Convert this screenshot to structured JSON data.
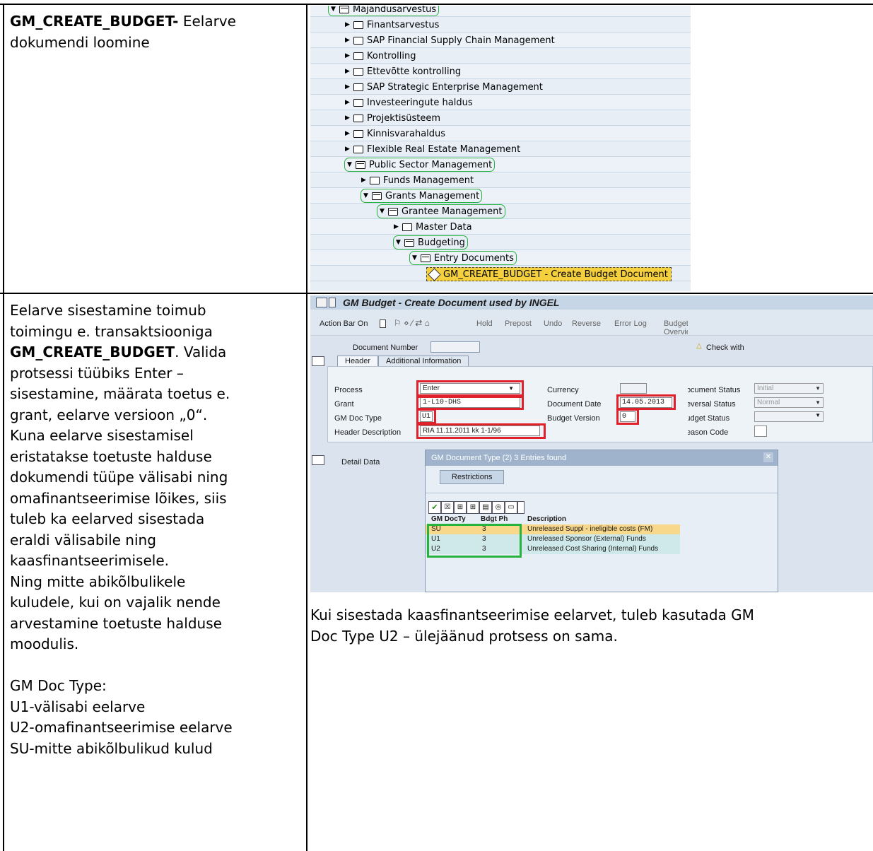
{
  "row1": {
    "left_bold": "GM_CREATE_BUDGET-",
    "left_rest": " Eelarve",
    "left_line2": "dokumendi loomine",
    "tree": [
      {
        "label": "Majandusarvestus",
        "open": true,
        "level": 0,
        "highlight": true
      },
      {
        "label": "Finantsarvestus",
        "open": false,
        "level": 1
      },
      {
        "label": "SAP Financial Supply Chain Management",
        "open": false,
        "level": 1
      },
      {
        "label": "Kontrolling",
        "open": false,
        "level": 1
      },
      {
        "label": "Ettevõtte kontrolling",
        "open": false,
        "level": 1
      },
      {
        "label": "SAP Strategic Enterprise Management",
        "open": false,
        "level": 1
      },
      {
        "label": "Investeeringute haldus",
        "open": false,
        "level": 1
      },
      {
        "label": "Projektisüsteem",
        "open": false,
        "level": 1
      },
      {
        "label": "Kinnisvarahaldus",
        "open": false,
        "level": 1
      },
      {
        "label": "Flexible Real Estate Management",
        "open": false,
        "level": 1
      },
      {
        "label": "Public Sector Management",
        "open": true,
        "level": 1,
        "highlight": true
      },
      {
        "label": "Funds Management",
        "open": false,
        "level": 2
      },
      {
        "label": "Grants Management",
        "open": true,
        "level": 2,
        "highlight": true
      },
      {
        "label": "Grantee Management",
        "open": true,
        "level": 3,
        "highlight": true
      },
      {
        "label": "Master Data",
        "open": false,
        "level": 4
      },
      {
        "label": "Budgeting",
        "open": true,
        "level": 4,
        "highlight": true
      },
      {
        "label": "Entry Documents",
        "open": true,
        "level": 5,
        "highlight": true
      },
      {
        "label": "GM_CREATE_BUDGET - Create Budget Document",
        "transaction": true,
        "level": 6
      }
    ]
  },
  "row2": {
    "left_lines": [
      [
        "Eelarve sisestamine toimub",
        ""
      ],
      [
        "toimingu e. transaktsiooniga",
        ""
      ],
      [
        "",
        "GM_CREATE_BUDGET",
        ". Valida"
      ],
      [
        "protsessi tüübiks Enter –",
        ""
      ],
      [
        "sisestamine, määrata toetus e.",
        ""
      ],
      [
        "grant, eelarve versioon „0“.",
        ""
      ],
      [
        "Kuna eelarve sisestamisel",
        ""
      ],
      [
        "eristatakse toetuste halduse",
        ""
      ],
      [
        "dokumendi tüüpe välisabi ning",
        ""
      ],
      [
        "omafinantseerimise lõikes, siis",
        ""
      ],
      [
        "tuleb ka eelarved sisestada",
        ""
      ],
      [
        "eraldi välisabile ning",
        ""
      ],
      [
        "kaasfinantseerimisele.",
        ""
      ],
      [
        "Ning mitte abikõlbulikele",
        ""
      ],
      [
        "kuludele, kui on vajalik nende",
        ""
      ],
      [
        "arvestamine toetuste halduse",
        ""
      ],
      [
        "moodulis.",
        ""
      ],
      [
        "",
        ""
      ],
      [
        "GM Doc Type:",
        ""
      ],
      [
        "U1-välisabi eelarve",
        ""
      ],
      [
        "U2-omafinantseerimise eelarve",
        ""
      ],
      [
        "SU-mitte abikõlbulikud kulud",
        ""
      ]
    ],
    "right_text_1": "Kui sisestada kaasfinantseerimise eelarvet, tuleb kasutada GM",
    "right_text_2": "Doc Type U2 – ülejäänud protsess on sama.",
    "sap": {
      "title": "GM Budget - Create Document used by INGEL",
      "toolbar": [
        "Action Bar On",
        "Hold",
        "Prepost",
        "Undo",
        "Reverse",
        "Error Log",
        "Budget Overview"
      ],
      "doc_number_label": "Document Number",
      "check_with": "Check with",
      "tabs": [
        "Header",
        "Additional Information"
      ],
      "fields_left": [
        {
          "label": "Process",
          "value": "Enter"
        },
        {
          "label": "Grant",
          "value": "1-L10-DHS"
        },
        {
          "label": "GM Doc Type",
          "value": "U1"
        },
        {
          "label": "Header Description",
          "value": "RIA 11.11.2011 kk 1-1/96"
        }
      ],
      "fields_mid": [
        {
          "label": "Currency",
          "value": ""
        },
        {
          "label": "Document Date",
          "value": "14.05.2013"
        },
        {
          "label": "Budget Version",
          "value": "0"
        }
      ],
      "fields_right": [
        {
          "label": "Document Status",
          "value": "Initial"
        },
        {
          "label": "Reversal Status",
          "value": "Normal"
        },
        {
          "label": "Budget Status",
          "value": ""
        },
        {
          "label": "Reason Code",
          "value": ""
        }
      ],
      "detail_data": "Detail Data",
      "popup_title": "GM Document Type (2)   3 Entries found",
      "popup_tab": "Restrictions",
      "popup_cols": [
        "GM DocTy",
        "Bdgt Ph",
        "Description"
      ],
      "popup_rows": [
        [
          "SU",
          "3",
          "Unreleased Suppl - ineligible costs (FM)"
        ],
        [
          "U1",
          "3",
          "Unreleased Sponsor (External) Funds"
        ],
        [
          "U2",
          "3",
          "Unreleased Cost Sharing (Internal) Funds"
        ]
      ]
    }
  },
  "colors": {
    "green": "#28b33e",
    "red": "#e0202a",
    "sap_bg": "#dbe4ee",
    "highlight_row": "#f4d03f"
  }
}
